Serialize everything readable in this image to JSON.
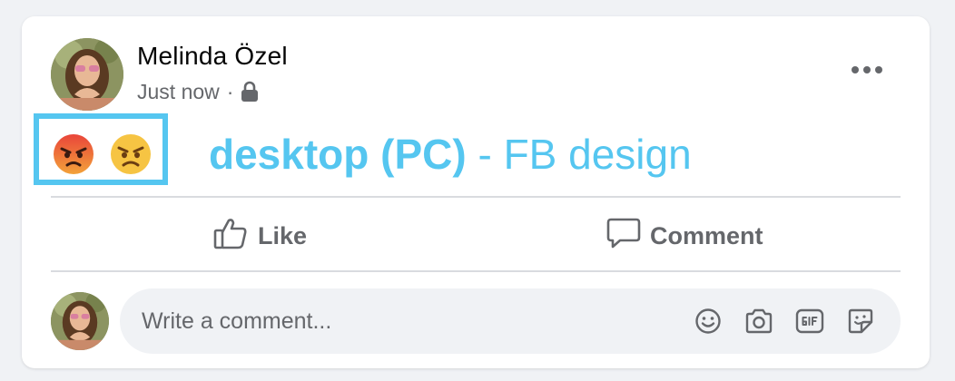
{
  "post": {
    "author_name": "Melinda Özel",
    "timestamp": "Just now",
    "separator": "·",
    "privacy_icon": "lock-icon",
    "more_icon": "more-options-icon"
  },
  "reactions": [
    {
      "icon": "angry-face-icon"
    },
    {
      "icon": "frowning-face-icon"
    }
  ],
  "caption": {
    "bold_part": "desktop (PC)",
    "rest": " - FB design"
  },
  "actions": {
    "like_label": "Like",
    "comment_label": "Comment"
  },
  "comment_box": {
    "placeholder": "Write a comment...",
    "tools": [
      "emoji-icon",
      "camera-icon",
      "gif-icon",
      "sticker-icon"
    ]
  },
  "colors": {
    "highlight": "#55c6f0",
    "caption": "#55c6f0",
    "secondary_text": "#65676b",
    "background": "#f0f2f5"
  }
}
